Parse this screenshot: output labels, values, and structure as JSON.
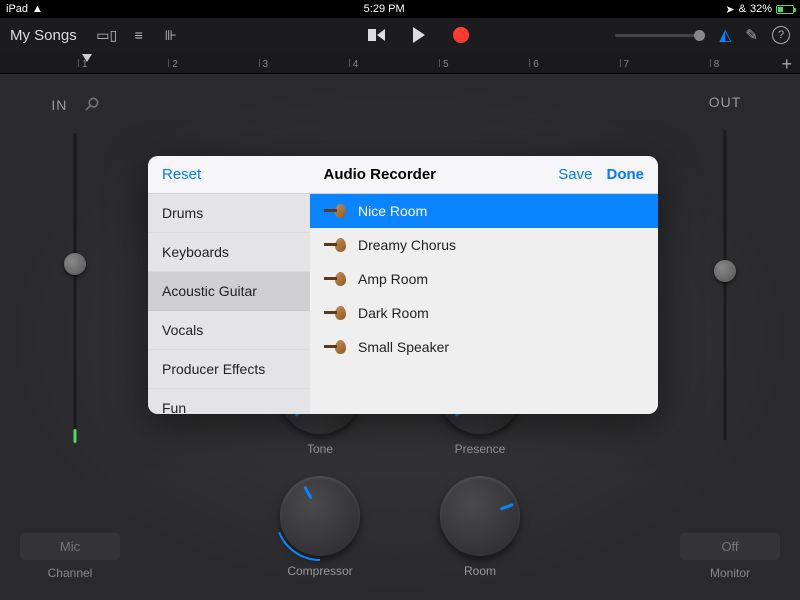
{
  "status": {
    "device": "iPad",
    "time": "5:29 PM",
    "battery_pct": "32%"
  },
  "topbar": {
    "title": "My Songs"
  },
  "ruler": {
    "marks": [
      "1",
      "2",
      "3",
      "4",
      "5",
      "6",
      "7",
      "8"
    ]
  },
  "io": {
    "in_label": "IN",
    "out_label": "OUT"
  },
  "knobs": [
    {
      "label": "Tone"
    },
    {
      "label": "Presence"
    },
    {
      "label": "Compressor"
    },
    {
      "label": "Room"
    }
  ],
  "bottom": {
    "mic": "Mic",
    "channel": "Channel",
    "off": "Off",
    "monitor": "Monitor"
  },
  "popover": {
    "reset": "Reset",
    "title": "Audio Recorder",
    "save": "Save",
    "done": "Done",
    "categories": [
      "Drums",
      "Keyboards",
      "Acoustic Guitar",
      "Vocals",
      "Producer Effects",
      "Fun"
    ],
    "selected_category": 2,
    "presets": [
      "Nice Room",
      "Dreamy Chorus",
      "Amp Room",
      "Dark Room",
      "Small Speaker"
    ],
    "selected_preset": 0
  }
}
